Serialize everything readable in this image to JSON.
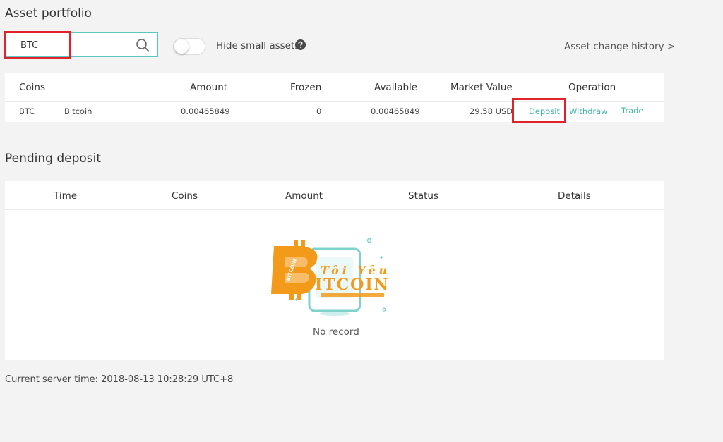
{
  "portfolio": {
    "title": "Asset portfolio",
    "search": {
      "value": "BTC"
    },
    "hide_small_label": "Hide small assets",
    "history_link": "Asset change history >",
    "columns": [
      "Coins",
      "Amount",
      "Frozen",
      "Available",
      "Market Value",
      "Operation"
    ],
    "row": {
      "symbol": "BTC",
      "name": "Bitcoin",
      "amount": "0.00465849",
      "frozen": "0",
      "available": "0.00465849",
      "market_value": "29.58 USD",
      "deposit": "Deposit",
      "withdraw": "Withdraw",
      "trade": "Trade"
    }
  },
  "pending": {
    "title": "Pending deposit",
    "columns": [
      "Time",
      "Coins",
      "Amount",
      "Status",
      "Details"
    ],
    "empty_text": "No record"
  },
  "watermark": {
    "line1": "Tôi Yêu",
    "line2": "ITCOIN",
    "badge": "BITCOIN"
  },
  "footer": {
    "server_time": "Current server time: 2018-08-13 10:28:29 UTC+8"
  },
  "colors": {
    "accent": "#44b3ad",
    "highlight": "#e0222b",
    "watermark": "#f39a1a"
  }
}
